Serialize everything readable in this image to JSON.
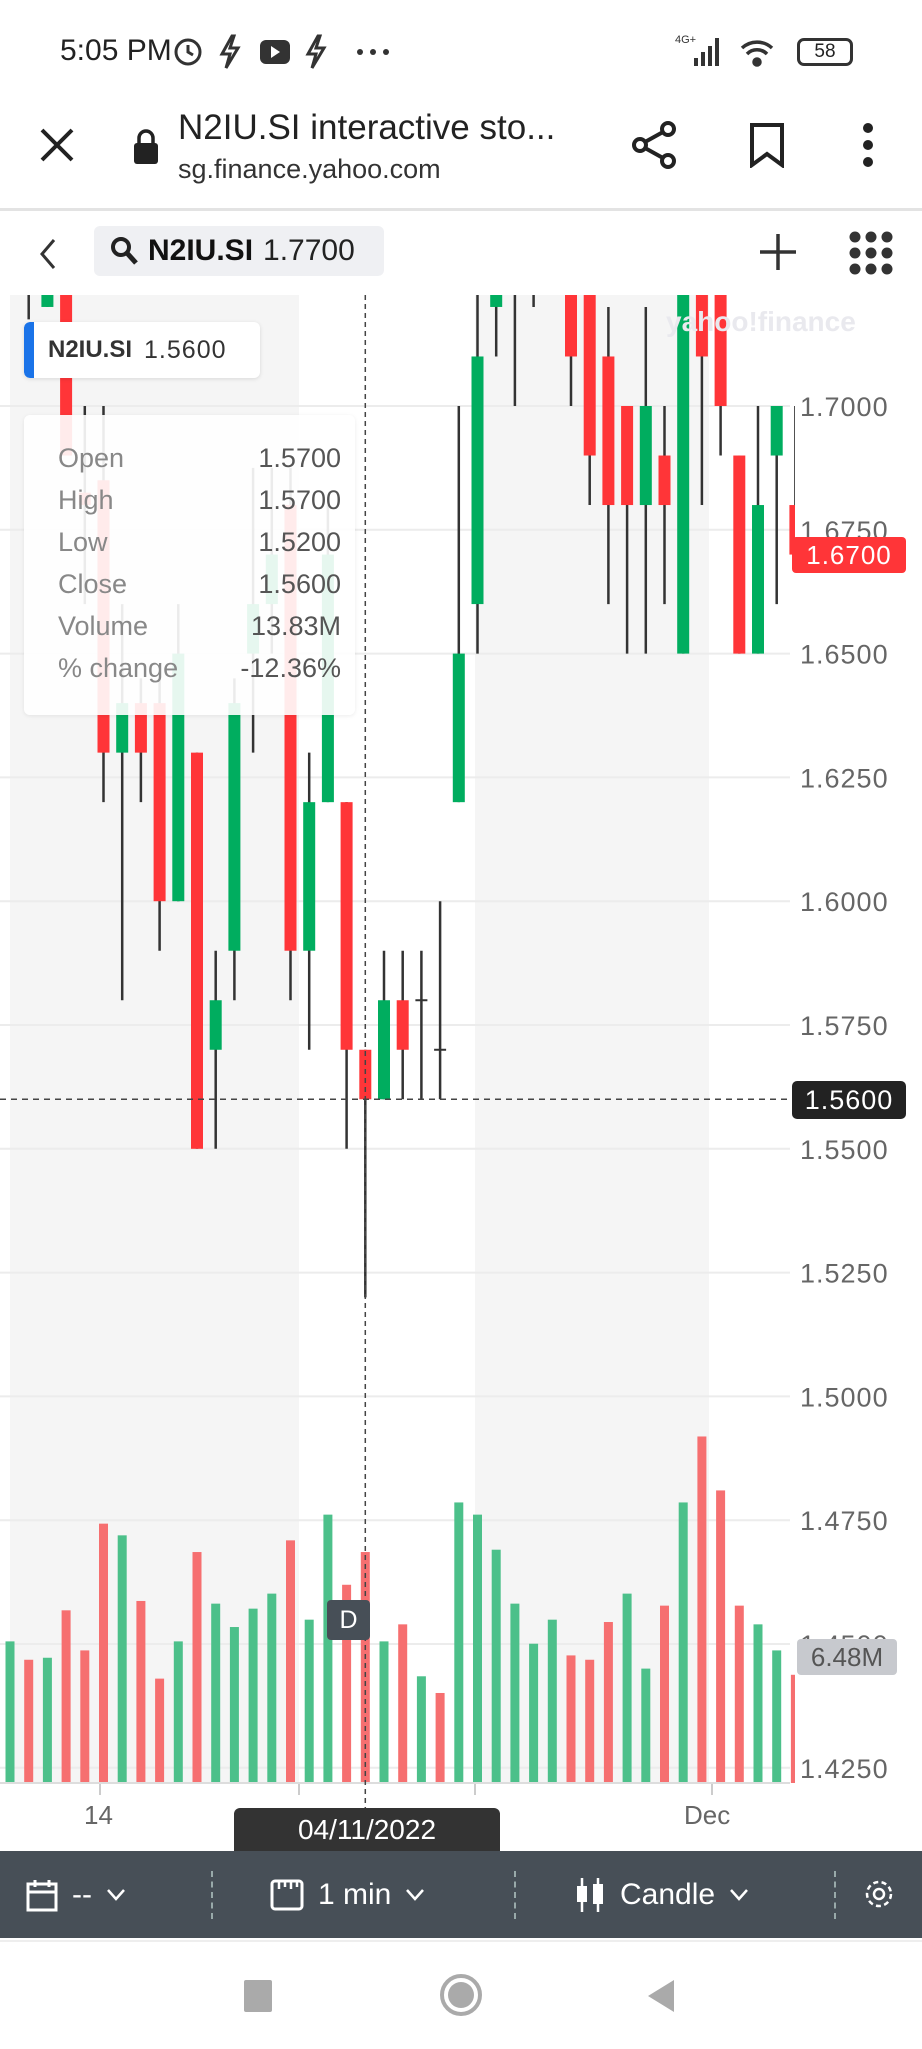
{
  "status_bar": {
    "time": "5:05 PM",
    "network": "4G+",
    "battery": "58",
    "icons": [
      "alarm-icon",
      "flash-icon",
      "youtube-icon",
      "flash-icon",
      "more-icon",
      "signal-icon",
      "wifi-icon",
      "battery-icon"
    ]
  },
  "browser": {
    "title": "N2IU.SI interactive sto...",
    "url": "sg.finance.yahoo.com"
  },
  "chart_header": {
    "symbol": "N2IU.SI",
    "price": "1.7700"
  },
  "legend": {
    "symbol": "N2IU.SI",
    "value": "1.5600"
  },
  "tooltip": {
    "rows": [
      {
        "label": "Open",
        "value": "1.5700"
      },
      {
        "label": "High",
        "value": "1.5700"
      },
      {
        "label": "Low",
        "value": "1.5200"
      },
      {
        "label": "Close",
        "value": "1.5600"
      },
      {
        "label": "Volume",
        "value": "13.83M"
      },
      {
        "label": "% change",
        "value": "-12.36%"
      }
    ]
  },
  "watermark": "yahoo!finance",
  "crosshair": {
    "price_label": "1.5600",
    "date_label": "04/11/2022",
    "badge": "D"
  },
  "current_price_label": "1.6700",
  "volume_label": "6.48M",
  "colors": {
    "up": "#00ad5f",
    "down": "#ff3538",
    "vol_up": "#4cc08a",
    "vol_down": "#f66f70",
    "current": "#ff3538"
  },
  "toolbar": {
    "range": "--",
    "interval": "1 min",
    "chart_type": "Candle"
  },
  "chart_data": {
    "type": "candlestick",
    "y_ticks": [
      "1.7000",
      "1.6750",
      "1.6500",
      "1.6250",
      "1.6000",
      "1.5750",
      "1.5500",
      "1.5250",
      "1.5000",
      "1.4750",
      "1.4500",
      "1.4250"
    ],
    "x_ticks": [
      "14",
      "Dec"
    ],
    "selected_index": 19,
    "candles": [
      {
        "o": 1.735,
        "h": 1.74,
        "l": 1.73,
        "c": 1.74,
        "v": 8.48,
        "up": true,
        "vup": true
      },
      {
        "o": 1.73,
        "h": 1.735,
        "l": 1.7175,
        "c": 1.725,
        "v": 7.38,
        "up": false,
        "vup": false
      },
      {
        "o": 1.72,
        "h": 1.725,
        "l": 1.72,
        "c": 1.7225,
        "v": 7.5,
        "up": true,
        "vup": true
      },
      {
        "o": 1.735,
        "h": 1.74,
        "l": 1.69,
        "c": 1.69,
        "v": 10.34,
        "up": false,
        "vup": false
      },
      {
        "o": 1.6825,
        "h": 1.7,
        "l": 1.66,
        "c": 1.68,
        "v": 7.94,
        "up": false,
        "vup": false
      },
      {
        "o": 1.685,
        "h": 1.7,
        "l": 1.62,
        "c": 1.63,
        "v": 15.53,
        "up": false,
        "vup": false
      },
      {
        "o": 1.63,
        "h": 1.66,
        "l": 1.58,
        "c": 1.64,
        "v": 14.83,
        "up": true,
        "vup": true
      },
      {
        "o": 1.64,
        "h": 1.645,
        "l": 1.62,
        "c": 1.63,
        "v": 10.9,
        "up": false,
        "vup": false
      },
      {
        "o": 1.64,
        "h": 1.645,
        "l": 1.59,
        "c": 1.6,
        "v": 6.25,
        "up": false,
        "vup": false
      },
      {
        "o": 1.6,
        "h": 1.66,
        "l": 1.6,
        "c": 1.65,
        "v": 8.48,
        "up": true,
        "vup": true
      },
      {
        "o": 1.63,
        "h": 1.63,
        "l": 1.55,
        "c": 1.55,
        "v": 13.83,
        "up": false,
        "vup": false
      },
      {
        "o": 1.57,
        "h": 1.59,
        "l": 1.55,
        "c": 1.58,
        "v": 10.74,
        "up": true,
        "vup": true
      },
      {
        "o": 1.59,
        "h": 1.645,
        "l": 1.58,
        "c": 1.64,
        "v": 9.34,
        "up": true,
        "vup": true
      },
      {
        "o": 1.65,
        "h": 1.6875,
        "l": 1.63,
        "c": 1.66,
        "v": 10.44,
        "up": true,
        "vup": true
      },
      {
        "o": 1.66,
        "h": 1.6875,
        "l": 1.65,
        "c": 1.67,
        "v": 11.34,
        "up": true,
        "vup": true
      },
      {
        "o": 1.68,
        "h": 1.6875,
        "l": 1.58,
        "c": 1.59,
        "v": 14.53,
        "up": false,
        "vup": false
      },
      {
        "o": 1.59,
        "h": 1.63,
        "l": 1.57,
        "c": 1.62,
        "v": 9.78,
        "up": true,
        "vup": true
      },
      {
        "o": 1.62,
        "h": 1.68,
        "l": 1.62,
        "c": 1.67,
        "v": 16.07,
        "up": true,
        "vup": true
      },
      {
        "o": 1.62,
        "h": 1.62,
        "l": 1.55,
        "c": 1.57,
        "v": 11.87,
        "up": false,
        "vup": false
      },
      {
        "o": 1.57,
        "h": 1.57,
        "l": 1.52,
        "c": 1.56,
        "v": 13.83,
        "up": false,
        "vup": false
      },
      {
        "o": 1.56,
        "h": 1.59,
        "l": 1.56,
        "c": 1.58,
        "v": 8.48,
        "up": true,
        "vup": true
      },
      {
        "o": 1.58,
        "h": 1.59,
        "l": 1.56,
        "c": 1.57,
        "v": 9.5,
        "up": false,
        "vup": false
      },
      {
        "o": 1.58,
        "h": 1.59,
        "l": 1.56,
        "c": 1.58,
        "v": 6.39,
        "up": true,
        "vup": true
      },
      {
        "o": 1.57,
        "h": 1.6,
        "l": 1.56,
        "c": 1.57,
        "v": 5.39,
        "up": false,
        "vup": false
      },
      {
        "o": 1.62,
        "h": 1.7,
        "l": 1.62,
        "c": 1.65,
        "v": 16.8,
        "up": true,
        "vup": true
      },
      {
        "o": 1.66,
        "h": 1.725,
        "l": 1.65,
        "c": 1.71,
        "v": 16.07,
        "up": true,
        "vup": true
      },
      {
        "o": 1.72,
        "h": 1.725,
        "l": 1.71,
        "c": 1.7225,
        "v": 13.97,
        "up": true,
        "vup": true
      },
      {
        "o": 1.725,
        "h": 1.735,
        "l": 1.7,
        "c": 1.73,
        "v": 10.74,
        "up": true,
        "vup": true
      },
      {
        "o": 1.73,
        "h": 1.74,
        "l": 1.72,
        "c": 1.735,
        "v": 8.34,
        "up": true,
        "vup": true
      },
      {
        "o": 1.735,
        "h": 1.745,
        "l": 1.73,
        "c": 1.74,
        "v": 9.78,
        "up": true,
        "vup": true
      },
      {
        "o": 1.73,
        "h": 1.735,
        "l": 1.7,
        "c": 1.71,
        "v": 7.64,
        "up": false,
        "vup": false
      },
      {
        "o": 1.73,
        "h": 1.735,
        "l": 1.68,
        "c": 1.69,
        "v": 7.38,
        "up": false,
        "vup": false
      },
      {
        "o": 1.71,
        "h": 1.72,
        "l": 1.66,
        "c": 1.68,
        "v": 9.64,
        "up": false,
        "vup": false
      },
      {
        "o": 1.7,
        "h": 1.7,
        "l": 1.65,
        "c": 1.68,
        "v": 11.34,
        "up": false,
        "vup": true
      },
      {
        "o": 1.68,
        "h": 1.72,
        "l": 1.65,
        "c": 1.7,
        "v": 6.85,
        "up": true,
        "vup": true
      },
      {
        "o": 1.69,
        "h": 1.7,
        "l": 1.66,
        "c": 1.68,
        "v": 10.62,
        "up": false,
        "vup": false
      },
      {
        "o": 1.65,
        "h": 1.735,
        "l": 1.65,
        "c": 1.73,
        "v": 16.8,
        "up": true,
        "vup": true
      },
      {
        "o": 1.73,
        "h": 1.735,
        "l": 1.68,
        "c": 1.71,
        "v": 20.75,
        "up": false,
        "vup": false
      },
      {
        "o": 1.73,
        "h": 1.735,
        "l": 1.69,
        "c": 1.7,
        "v": 17.52,
        "up": false,
        "vup": false
      },
      {
        "o": 1.69,
        "h": 1.69,
        "l": 1.65,
        "c": 1.65,
        "v": 10.62,
        "up": false,
        "vup": false
      },
      {
        "o": 1.65,
        "h": 1.7,
        "l": 1.65,
        "c": 1.68,
        "v": 9.5,
        "up": true,
        "vup": true
      },
      {
        "o": 1.69,
        "h": 1.7,
        "l": 1.66,
        "c": 1.7,
        "v": 7.94,
        "up": true,
        "vup": true
      },
      {
        "o": 1.68,
        "h": 1.7,
        "l": 1.67,
        "c": 1.67,
        "v": 6.48,
        "up": false,
        "vup": false
      }
    ]
  }
}
